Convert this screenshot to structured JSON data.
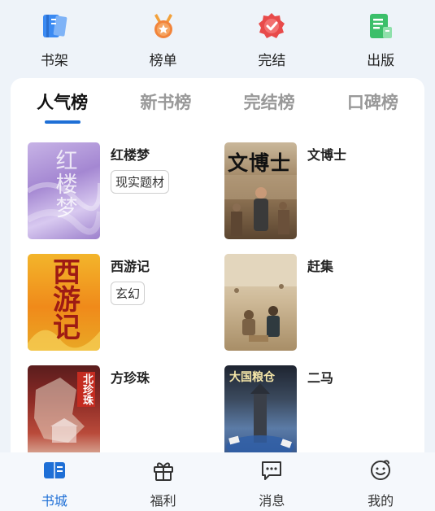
{
  "quick_nav": [
    {
      "label": "书架",
      "icon": "bookshelf-icon",
      "color": "#3b8af2"
    },
    {
      "label": "榜单",
      "icon": "medal-icon",
      "color": "#f2843b"
    },
    {
      "label": "完结",
      "icon": "completed-badge-icon",
      "color": "#e84a4a"
    },
    {
      "label": "出版",
      "icon": "publish-icon",
      "color": "#3bbf6a"
    }
  ],
  "tabs": [
    {
      "label": "人气榜",
      "active": true
    },
    {
      "label": "新书榜",
      "active": false
    },
    {
      "label": "完结榜",
      "active": false
    },
    {
      "label": "口碑榜",
      "active": false
    }
  ],
  "covers": {
    "hongloumeng": "红楼梦",
    "wenboshi": "文博士",
    "xiyouji": "西游记",
    "fangzhenzhu": "北珍珠",
    "erma": "大国粮仓"
  },
  "books": [
    {
      "title": "红楼梦",
      "tag": "现实题材"
    },
    {
      "title": "文博士",
      "tag": ""
    },
    {
      "title": "西游记",
      "tag": "玄幻"
    },
    {
      "title": "赶集",
      "tag": ""
    },
    {
      "title": "方珍珠",
      "tag": ""
    },
    {
      "title": "二马",
      "tag": ""
    }
  ],
  "bottom_nav": [
    {
      "label": "书城",
      "icon": "bookstore-icon",
      "active": true
    },
    {
      "label": "福利",
      "icon": "gift-icon",
      "active": false
    },
    {
      "label": "消息",
      "icon": "message-icon",
      "active": false
    },
    {
      "label": "我的",
      "icon": "profile-icon",
      "active": false
    }
  ],
  "colors": {
    "accent": "#1e6fd6",
    "background": "#eef3f9"
  }
}
